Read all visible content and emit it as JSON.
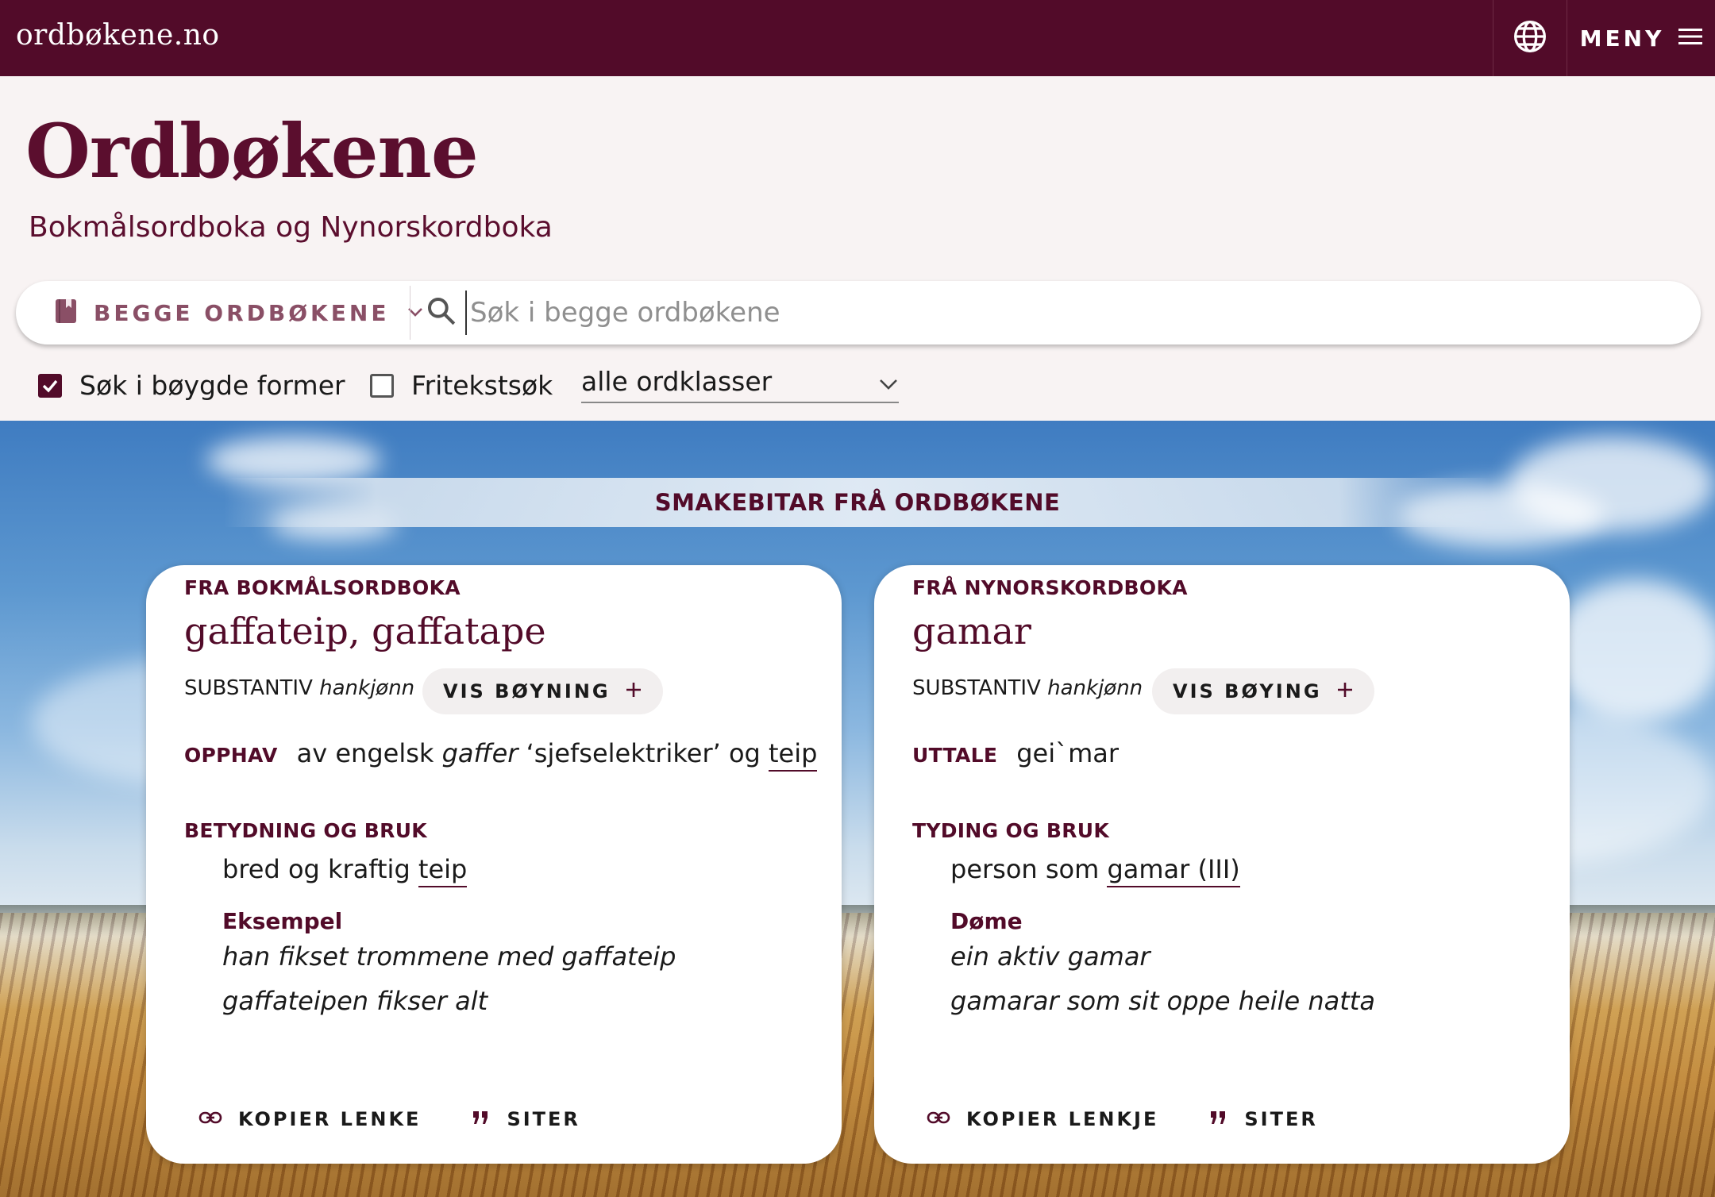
{
  "topbar": {
    "site_name": "ordbøkene.no",
    "menu_label": "MENY"
  },
  "header": {
    "title": "Ordbøkene",
    "subtitle": "Bokmålsordboka og Nynorskordboka"
  },
  "search": {
    "dictionary_label": "BEGGE ORDBØKENE",
    "placeholder": "Søk i begge ordbøkene",
    "value": ""
  },
  "options": {
    "inflected_label": "Søk i bøygde former",
    "inflected_checked": true,
    "fulltext_label": "Fritekstsøk",
    "fulltext_checked": false,
    "word_class": "alle ordklasser"
  },
  "banner": {
    "title": "SMAKEBITAR FRÅ ORDBØKENE"
  },
  "cards": [
    {
      "source": "FRA BOKMÅLSORDBOKA",
      "headword": "gaffateip, gaffatape",
      "pos": "SUBSTANTIV",
      "gender": "hankjønn",
      "inflect_label": "VIS BØYNING",
      "field_label": "OPPHAV",
      "field_prefix": "av engelsk",
      "field_italic": "gaffer",
      "field_mid": "‘sjefselektriker’ og",
      "field_link": "teip",
      "section_label": "BETYDNING OG BRUK",
      "meaning_text": "bred og kraftig",
      "meaning_link": "teip",
      "example_label": "Eksempel",
      "examples": [
        "han fikset trommene med gaffateip",
        "gaffateipen fikser alt"
      ],
      "copy_label": "KOPIER LENKE",
      "cite_label": "SITER"
    },
    {
      "source": "FRÅ NYNORSKORDBOKA",
      "headword": "gamar",
      "pos": "SUBSTANTIV",
      "gender": "hankjønn",
      "inflect_label": "VIS BØYING",
      "field_label": "UTTALE",
      "field_value": "gei`mar",
      "section_label": "TYDING OG BRUK",
      "meaning_text": "person som",
      "meaning_link": "gamar (III)",
      "example_label": "Døme",
      "examples": [
        "ein aktiv gamar",
        "gamarar som sit oppe heile natta"
      ],
      "copy_label": "KOPIER LENKJE",
      "cite_label": "SITER"
    }
  ],
  "colors": {
    "brand": "#520b29",
    "background": "#f8f3f3"
  }
}
